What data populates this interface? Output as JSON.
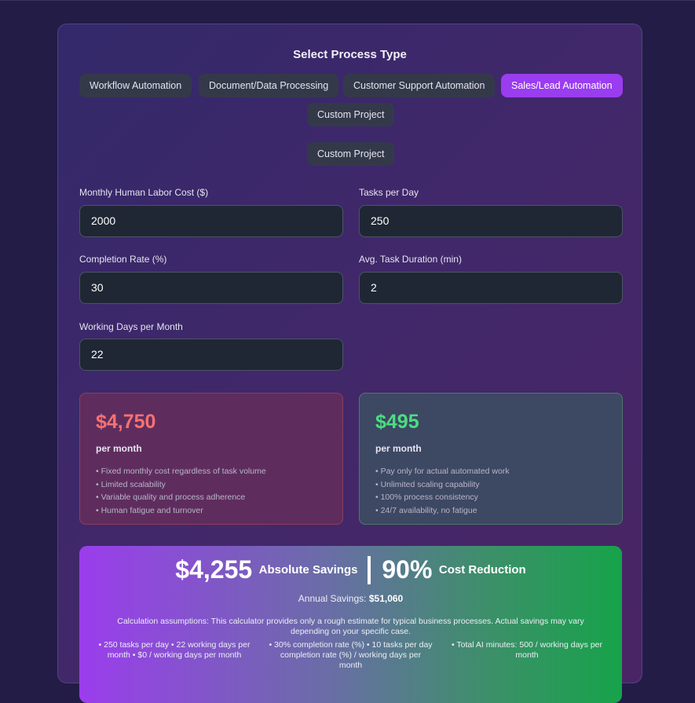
{
  "title": "Select Process Type",
  "process_types": [
    {
      "label": "Workflow Automation",
      "active": false
    },
    {
      "label": "Document/Data Processing",
      "active": false
    },
    {
      "label": "Customer Support Automation",
      "active": false
    },
    {
      "label": "Sales/Lead Automation",
      "active": true
    },
    {
      "label": "Custom Project",
      "active": false
    }
  ],
  "custom_project_button": "Custom Project",
  "fields": {
    "monthly_labor_cost": {
      "label": "Monthly Human Labor Cost ($)",
      "value": "2000"
    },
    "tasks_per_day": {
      "label": "Tasks per Day",
      "value": "250"
    },
    "completion_rate": {
      "label": "Completion Rate (%)",
      "value": "30"
    },
    "avg_task_duration": {
      "label": "Avg. Task Duration (min)",
      "value": "2"
    },
    "working_days": {
      "label": "Working Days per Month",
      "value": "22"
    }
  },
  "human_cost": {
    "amount": "$4,750",
    "period": "per month",
    "points": [
      "Fixed monthly cost regardless of task volume",
      "Limited scalability",
      "Variable quality and process adherence",
      "Human fatigue and turnover"
    ]
  },
  "ai_cost": {
    "amount": "$495",
    "period": "per month",
    "points": [
      "Pay only for actual automated work",
      "Unlimited scaling capability",
      "100% process consistency",
      "24/7 availability, no fatigue"
    ]
  },
  "savings": {
    "absolute_value": "$4,255",
    "absolute_label": "Absolute Savings",
    "percent_value": "90%",
    "percent_label": "Cost Reduction",
    "annual_label": "Annual Savings:",
    "annual_value": "$51,060",
    "assumptions": "Calculation assumptions: This calculator provides only a rough estimate for typical business processes. Actual savings may vary depending on your specific case.",
    "details": [
      "• 250 tasks per day • 22 working days per month • $0 / working days per month",
      "• 30% completion rate (%) • 10 tasks per day completion rate (%) / working days per month",
      "• Total AI minutes: 500 / working days per month"
    ]
  },
  "colors": {
    "accent": "#9a3cf0",
    "human_amount": "#f87171",
    "ai_amount": "#4ade80",
    "savings_gradient_start": "#9b3ded",
    "savings_gradient_end": "#16a34a"
  }
}
